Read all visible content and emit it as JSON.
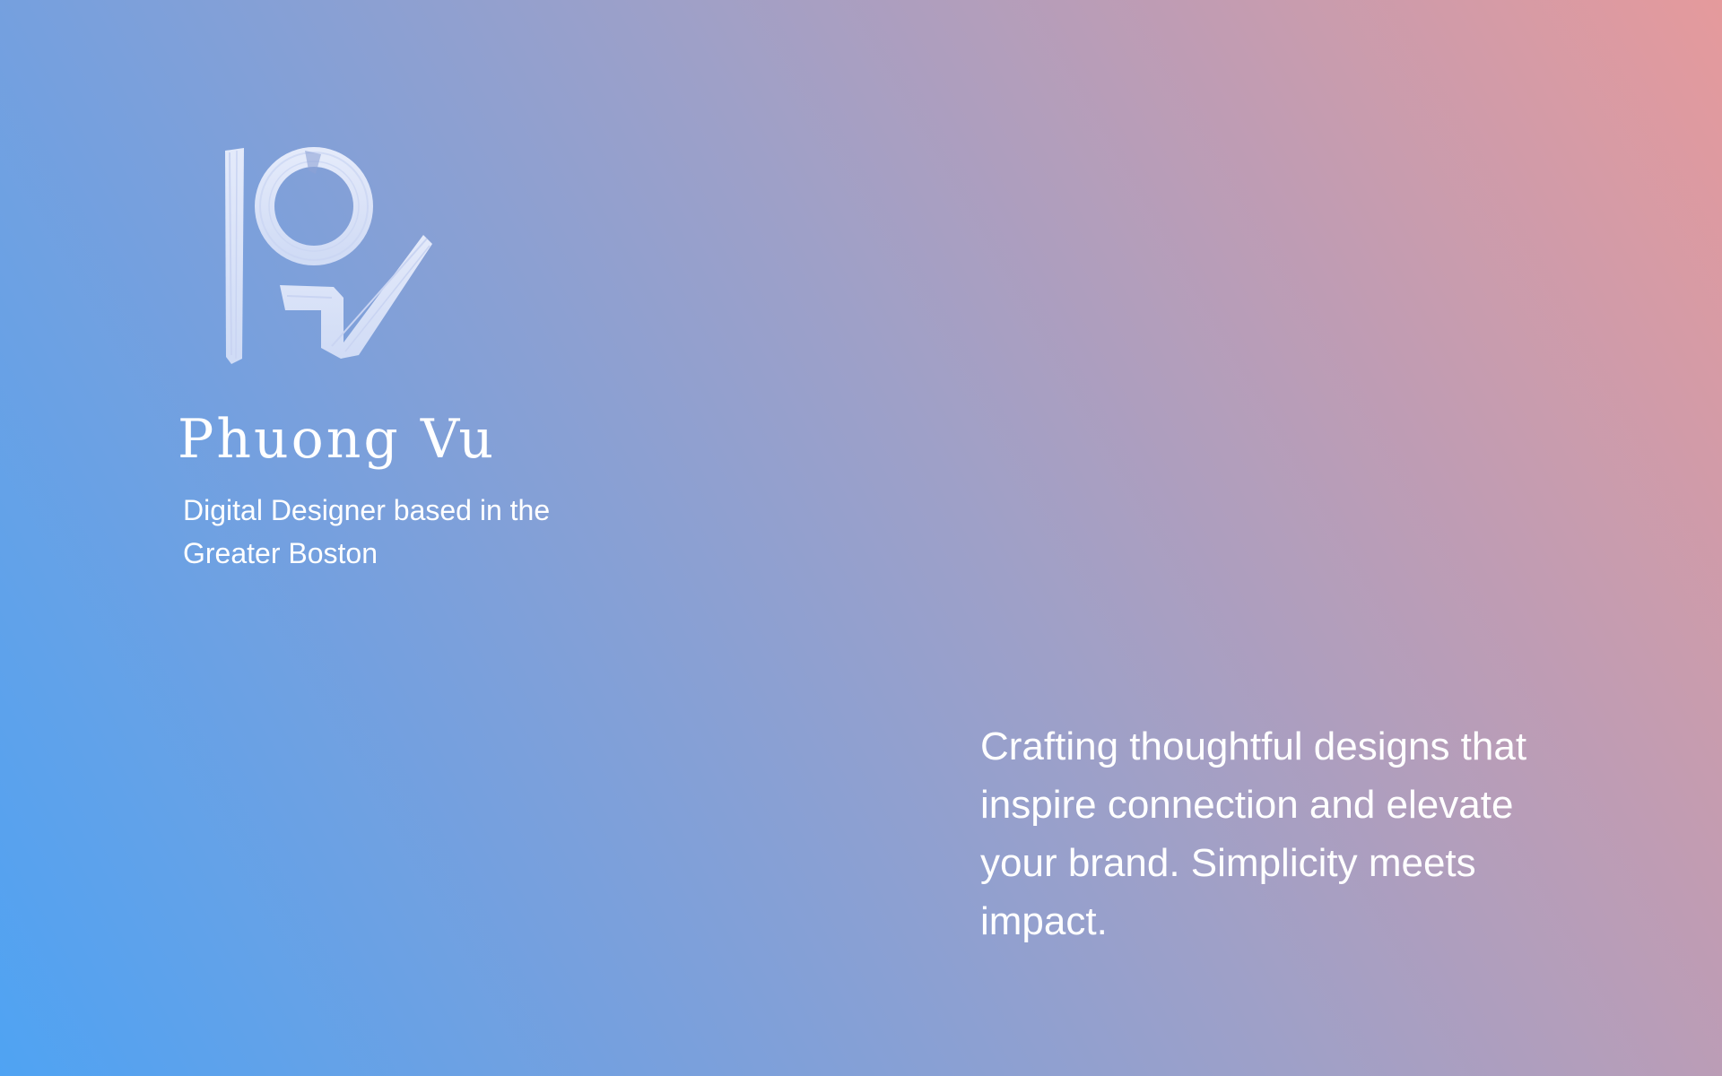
{
  "brand": {
    "logo_icon": "pv-brush-monogram-icon",
    "name": "Phuong Vu",
    "subtitle": "Digital Designer based in the Greater Boston"
  },
  "hero": {
    "tagline": "Crafting thoughtful designs that inspire connection and elevate your brand. Simplicity meets impact."
  },
  "colors": {
    "gradient_start": "#4fa3f3",
    "gradient_mid": "#9ea0c8",
    "gradient_end": "#e59a9c",
    "text": "#ffffff"
  }
}
